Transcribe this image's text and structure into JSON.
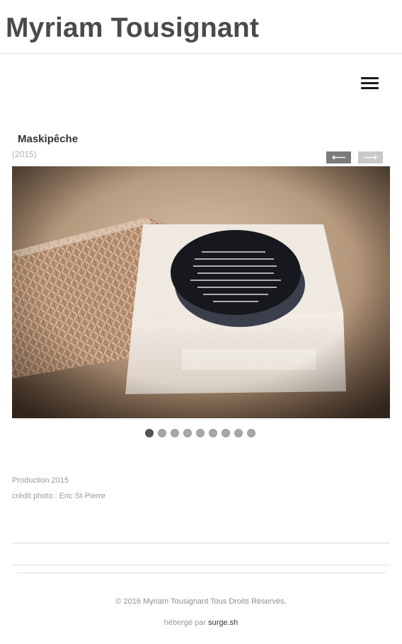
{
  "site": {
    "title": "Myriam Tousignant"
  },
  "menu": {
    "icon": "hamburger-menu-icon"
  },
  "project": {
    "title": "Maskipêche",
    "year": "(2015)",
    "prev_icon": "arrow-left-icon",
    "next_icon": "arrow-right-icon"
  },
  "slider": {
    "slide_count": 9,
    "active_index": 0
  },
  "details": {
    "production": "Production 2015",
    "credit": "crédit photo : Eric St-Pierre"
  },
  "footer": {
    "copyright": "© 2016 Myriam Tousignant Tous Droits Réservés.",
    "hosted_prefix": "hébergé par",
    "hosted_link": "surge.sh"
  },
  "colors": {
    "active_dot": "#555555",
    "inactive_dot": "#a7a7a7",
    "prev_button": "#7b7b7b",
    "next_button": "#c9c9c9"
  }
}
